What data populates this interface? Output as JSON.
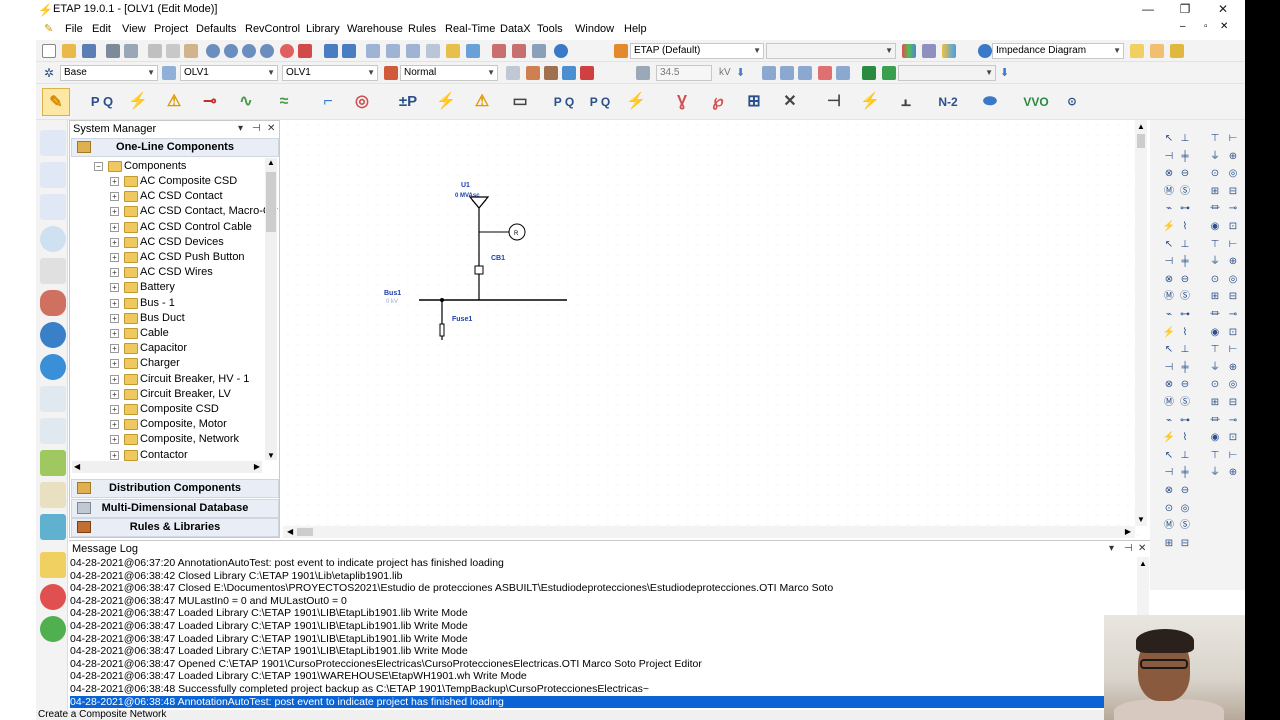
{
  "window": {
    "title": "ETAP 19.0.1 - [OLV1 (Edit Mode)]",
    "controls": [
      "—",
      "❐",
      "✕"
    ],
    "mdi_controls": [
      "–",
      "▫",
      "✕"
    ]
  },
  "menu": [
    "File",
    "Edit",
    "View",
    "Project",
    "Defaults",
    "RevControl",
    "Library",
    "Warehouse",
    "Rules",
    "Real-Time",
    "DataX",
    "Tools",
    "Window",
    "Help"
  ],
  "toolbar1": {
    "config_combo": "ETAP (Default)",
    "diagram_combo": "Impedance Diagram"
  },
  "toolbar2": {
    "presentation_combo": "Base",
    "olv_combo1": "OLV1",
    "olv_combo2": "OLV1",
    "mode_combo": "Normal",
    "voltage_value": "34.5",
    "voltage_unit": "kV"
  },
  "toolbar3": {
    "labels": [
      "±P",
      "N-2",
      "VVO"
    ]
  },
  "system_manager": {
    "title": "System Manager",
    "sections": {
      "one_line": "One-Line Components",
      "distribution": "Distribution Components",
      "mdd": "Multi-Dimensional Database",
      "rules": "Rules & Libraries"
    },
    "tree_root": "Components",
    "tree_items": [
      "AC Composite CSD",
      "AC CSD Contact",
      "AC CSD Contact, Macro-Ctr",
      "AC CSD Control Cable",
      "AC CSD Devices",
      "AC CSD Push Button",
      "AC CSD Wires",
      "Battery",
      "Bus - 1",
      "Bus Duct",
      "Cable",
      "Capacitor",
      "Charger",
      "Circuit Breaker, HV - 1",
      "Circuit Breaker, LV",
      "Composite CSD",
      "Composite, Motor",
      "Composite, Network",
      "Contactor"
    ]
  },
  "diagram": {
    "utility_id": "U1",
    "utility_rating": "0 MVAsc",
    "relay_symbol": "R",
    "breaker_id": "CB1",
    "bus_id": "Bus1",
    "bus_voltage": "0 kV",
    "fuse_id": "Fuse1"
  },
  "message_log": {
    "title": "Message Log",
    "lines": [
      "04-28-2021@06:37:20 AnnotationAutoTest: post event to indicate project has finished loading",
      "04-28-2021@06:38:42 Closed Library C:\\ETAP 1901\\Lib\\etaplib1901.lib",
      "04-28-2021@06:38:47 Closed E:\\Documentos\\PROYECTOS2021\\Estudio de protecciones ASBUILT\\Estudiodeprotecciones\\Estudiodeprotecciones.OTI Marco Soto",
      "04-28-2021@06:38:47 MULastIn0 = 0  and MULastOut0 = 0",
      "04-28-2021@06:38:47 Loaded Library C:\\ETAP 1901\\LIB\\EtapLib1901.lib Write Mode",
      "04-28-2021@06:38:47 Loaded Library C:\\ETAP 1901\\LIB\\EtapLib1901.lib Write Mode",
      "04-28-2021@06:38:47 Loaded Library C:\\ETAP 1901\\LIB\\EtapLib1901.lib Write Mode",
      "04-28-2021@06:38:47 Loaded Library C:\\ETAP 1901\\LIB\\EtapLib1901.lib Write Mode",
      "04-28-2021@06:38:47 Opened C:\\ETAP 1901\\CursoProteccionesElectricas\\CursoProteccionesElectricas.OTI Marco Soto Project Editor",
      "04-28-2021@06:38:47 Loaded Library C:\\ETAP 1901\\WAREHOUSE\\EtapWH1901.wh Write Mode",
      "04-28-2021@06:38:48 Successfully completed project backup as C:\\ETAP 1901\\TempBackup\\CursoProteccionesElectricas~",
      "04-28-2021@06:38:48 AnnotationAutoTest: post event to indicate project has finished loading"
    ]
  },
  "status": "Create a Composite Network",
  "colors": {
    "selection": "#0a64d6",
    "diagram_label": "#1a3fb0"
  }
}
